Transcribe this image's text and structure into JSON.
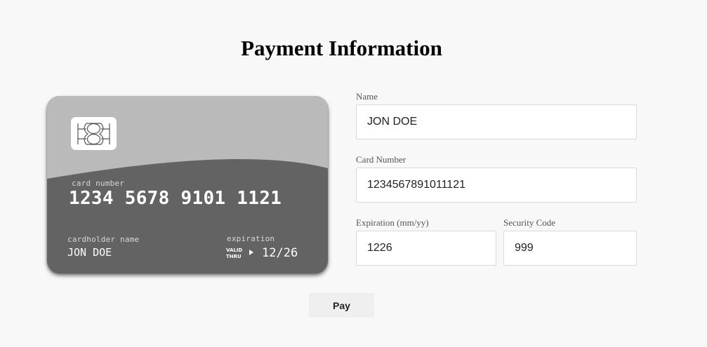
{
  "page": {
    "title": "Payment Information"
  },
  "card": {
    "number_label": "card number",
    "number": "1234 5678 9101 1121",
    "holder_label": "cardholder name",
    "holder_name": "JON DOE",
    "expiration_label": "expiration",
    "valid_thru": "VALID THRU",
    "expiration": "12/26",
    "colors": {
      "top": "#bababa",
      "bottom": "#636363",
      "chip": "#ffffff"
    }
  },
  "form": {
    "name": {
      "label": "Name",
      "value": "JON DOE"
    },
    "card_number": {
      "label": "Card Number",
      "value": "1234567891011121"
    },
    "expiration": {
      "label": "Expiration (mm/yy)",
      "value": "1226"
    },
    "security_code": {
      "label": "Security Code",
      "value": "999"
    },
    "submit_label": "Pay"
  }
}
